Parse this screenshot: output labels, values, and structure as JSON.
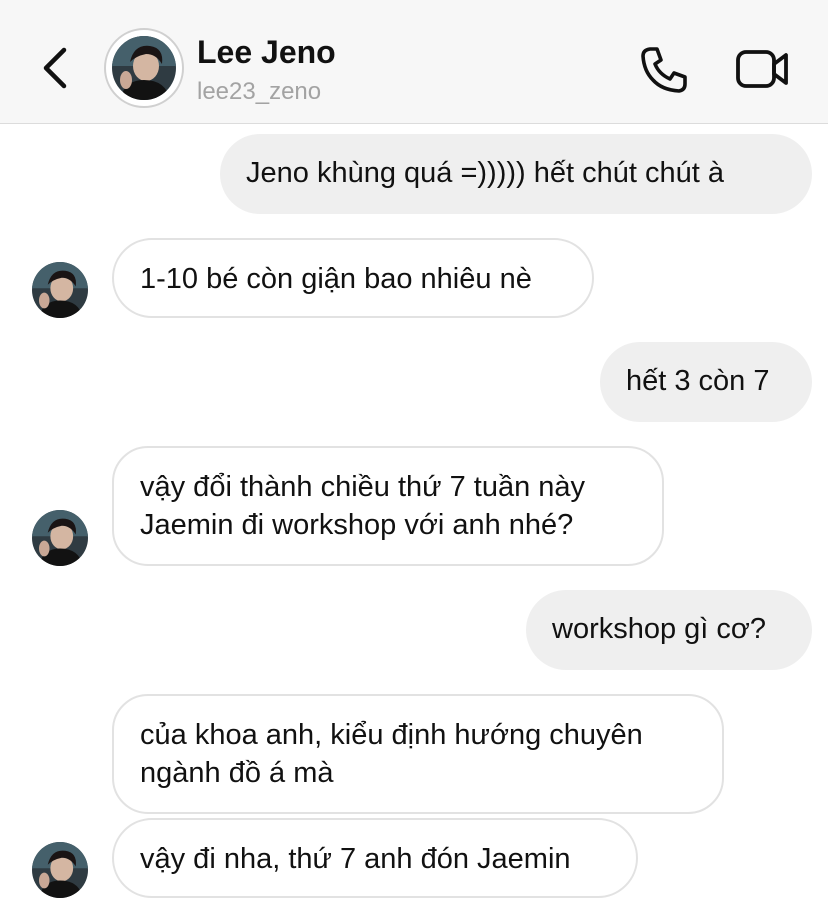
{
  "header": {
    "name": "Lee Jeno",
    "handle": "lee23_zeno",
    "icons": {
      "back": "chevron-left-icon",
      "call": "phone-icon",
      "video": "video-camera-icon"
    }
  },
  "messages": [
    {
      "sender": "me",
      "text": "Jeno khùng quá =))))) hết chút chút à"
    },
    {
      "sender": "them",
      "text": "1-10 bé còn giận bao nhiêu nè"
    },
    {
      "sender": "me",
      "text": "hết 3 còn 7"
    },
    {
      "sender": "them",
      "lines": [
        "vậy đổi thành chiều thứ 7 tuần này",
        "Jaemin đi workshop với anh nhé?"
      ]
    },
    {
      "sender": "me",
      "text": "workshop gì cơ?"
    },
    {
      "sender": "them",
      "lines": [
        "của khoa anh, kiểu định hướng chuyên",
        "ngành đồ á mà"
      ]
    },
    {
      "sender": "them",
      "text": "vậy đi nha, thứ 7 anh đón Jaemin"
    }
  ],
  "colors": {
    "header_bg": "#f7f7f7",
    "outgoing_bubble": "#efefef",
    "incoming_border": "#e2e2e2",
    "handle_text": "#a3a3a3"
  }
}
